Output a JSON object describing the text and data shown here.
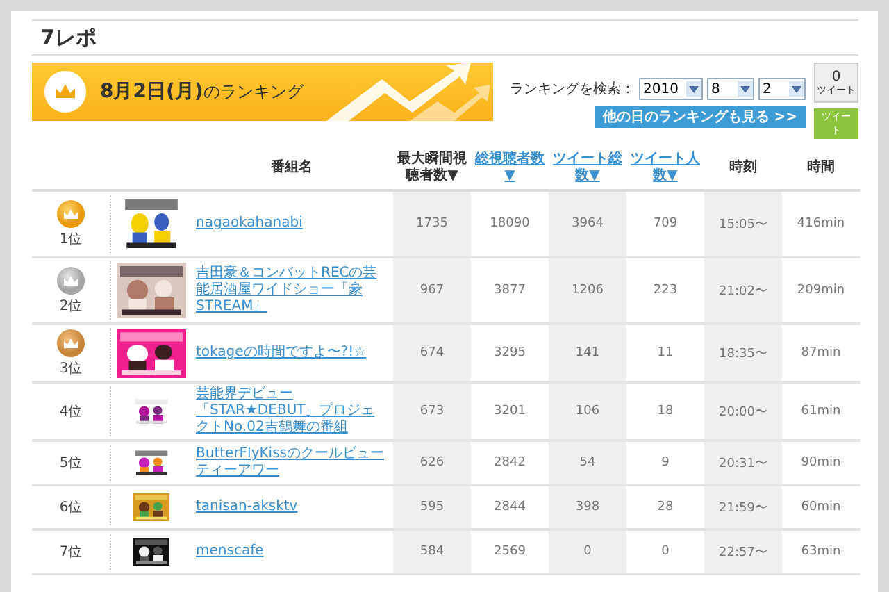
{
  "page_title": "7レポ",
  "banner": {
    "heading": "**8月2日(月)**のランキング"
  },
  "search": {
    "label": "ランキングを検索：",
    "year": "2010",
    "month": "8",
    "day": "2",
    "more_button": "他の日のランキングも見る >>"
  },
  "tweet_widget": {
    "count": "0",
    "count_label": "ツイート",
    "button": "ツイート"
  },
  "table": {
    "program_header": "番組名",
    "stat_columns": [
      {
        "label": "最大瞬間視聴者数▼",
        "link": false
      },
      {
        "label": "総視聴者数▼",
        "link": true
      },
      {
        "label": "ツイート総数▼",
        "link": true
      },
      {
        "label": "ツイート人数▼",
        "link": true
      },
      {
        "label": "時刻",
        "link": false
      },
      {
        "label": "時間",
        "link": false
      }
    ],
    "rows": [
      {
        "rank": "1位",
        "kind": "gold",
        "name": "nagaokahanabi",
        "stats": [
          "1735",
          "18090",
          "3964",
          "709",
          "15:05〜",
          "416min"
        ]
      },
      {
        "rank": "2位",
        "kind": "silver",
        "name": "吉田豪＆コンバットRECの芸能居酒屋ワイドショー「豪STREAM」",
        "stats": [
          "967",
          "3877",
          "1206",
          "223",
          "21:02〜",
          "209min"
        ]
      },
      {
        "rank": "3位",
        "kind": "bronze",
        "name": "tokageの時間ですよ〜?!☆",
        "stats": [
          "674",
          "3295",
          "141",
          "11",
          "18:35〜",
          "87min"
        ]
      },
      {
        "rank": "4位",
        "kind": "plain",
        "name": "芸能界デビュー「STAR★DEBUT」プロジェクトNo.02吉鶴舞の番組",
        "stats": [
          "673",
          "3201",
          "106",
          "18",
          "20:00〜",
          "61min"
        ]
      },
      {
        "rank": "5位",
        "kind": "plain",
        "name": "ButterFlyKissのクールビューティーアワー",
        "stats": [
          "626",
          "2842",
          "54",
          "9",
          "20:31〜",
          "90min"
        ]
      },
      {
        "rank": "6位",
        "kind": "plain",
        "name": "tanisan-aksktv",
        "stats": [
          "595",
          "2844",
          "398",
          "28",
          "21:59〜",
          "60min"
        ]
      },
      {
        "rank": "7位",
        "kind": "plain",
        "name": "menscafe",
        "stats": [
          "584",
          "2569",
          "0",
          "0",
          "22:57〜",
          "63min"
        ]
      }
    ]
  }
}
